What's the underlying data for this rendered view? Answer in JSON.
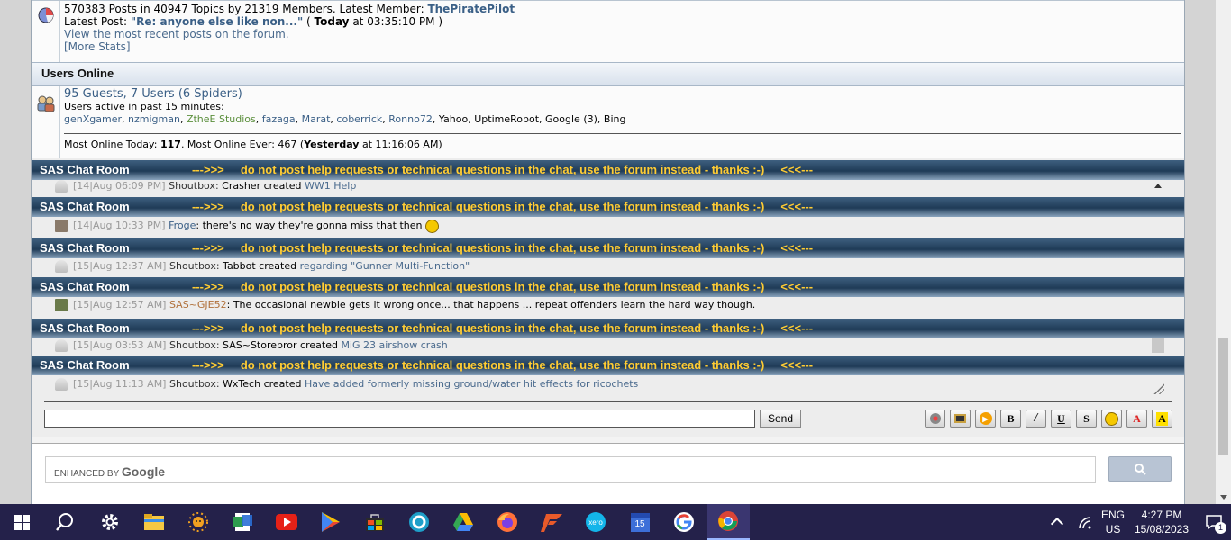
{
  "stats": {
    "line1_prefix": "570383 Posts in 40947 Topics by 21319 Members. Latest Member: ",
    "latest_member": "ThePiratePilot",
    "latest_post_prefix": "Latest Post: ",
    "latest_post_title": "\"Re: anyone else like non...\"",
    "latest_post_open": " ( ",
    "latest_post_day": "Today",
    "latest_post_time": " at 03:35:10 PM )",
    "recent_link": "View the most recent posts on the forum.",
    "more_stats": "[More Stats]"
  },
  "users_online": {
    "heading": "Users Online",
    "guests": "95 Guests, 7 Users (6 Spiders)",
    "active_label": "Users active in past 15 minutes:",
    "users": [
      {
        "name": "genXgamer",
        "kind": "u"
      },
      {
        "name": "nzmigman",
        "kind": "u"
      },
      {
        "name": "ZtheE Studios",
        "kind": "g"
      },
      {
        "name": "fazaga",
        "kind": "u"
      },
      {
        "name": "Marat",
        "kind": "u"
      },
      {
        "name": "coberrick",
        "kind": "u"
      },
      {
        "name": "Ronno72",
        "kind": "u"
      },
      {
        "name": "Yahoo",
        "kind": "b"
      },
      {
        "name": "UptimeRobot",
        "kind": "b"
      },
      {
        "name": "Google (3)",
        "kind": "b"
      },
      {
        "name": "Bing",
        "kind": "b"
      }
    ],
    "most_prefix": "Most Online Today: ",
    "most_today": "117",
    "most_ever_prefix": ". Most Online Ever: 467 (",
    "most_ever_day": "Yesterday",
    "most_ever_suffix": " at 11:16:06 AM)"
  },
  "chat": {
    "title": "SAS Chat Room",
    "notice": "--->>>     do not post help requests or technical questions in the chat, use the forum instead - thanks :-)     <<<---",
    "messages": [
      {
        "ts": "[14|Aug 06:09 PM]",
        "who": "Shoutbox:",
        "who_kind": "sys",
        "text": " Crasher created ",
        "link": "WW1 Help"
      },
      {
        "ts": "[14|Aug 10:33 PM]",
        "who": "Froge",
        "who_kind": "user",
        "text": ": there's no way they're gonna miss that then ",
        "link": ""
      },
      {
        "ts": "[15|Aug 12:37 AM]",
        "who": "Shoutbox:",
        "who_kind": "sys",
        "text": " Tabbot created ",
        "link": "regarding \"Gunner Multi-Function\""
      },
      {
        "ts": "[15|Aug 12:57 AM]",
        "who": "SAS~GJE52",
        "who_kind": "sas",
        "text": ": The occasional newbie gets it wrong once... that happens ... repeat offenders learn the hard way though.",
        "link": ""
      },
      {
        "ts": "[15|Aug 03:53 AM]",
        "who": "Shoutbox:",
        "who_kind": "sys",
        "text": " SAS~Storebror created ",
        "link": "MiG 23 airshow crash"
      },
      {
        "ts": "[15|Aug 11:13 AM]",
        "who": "Shoutbox:",
        "who_kind": "sys",
        "text": " WxTech created ",
        "link": "Have added formerly missing ground/water hit effects for ricochets"
      }
    ],
    "input_value": "",
    "send_label": "Send",
    "tools": [
      "P",
      "img",
      "▶",
      "B",
      "I",
      "U",
      "S",
      "☺",
      "A",
      "A"
    ]
  },
  "search": {
    "enhanced_by": "ENHANCED BY ",
    "brand": "Google"
  },
  "taskbar": {
    "lang_top": "ENG",
    "lang_bottom": "US",
    "time": "4:27 PM",
    "date": "15/08/2023",
    "notif_count": "1",
    "calendar_day": "15"
  }
}
